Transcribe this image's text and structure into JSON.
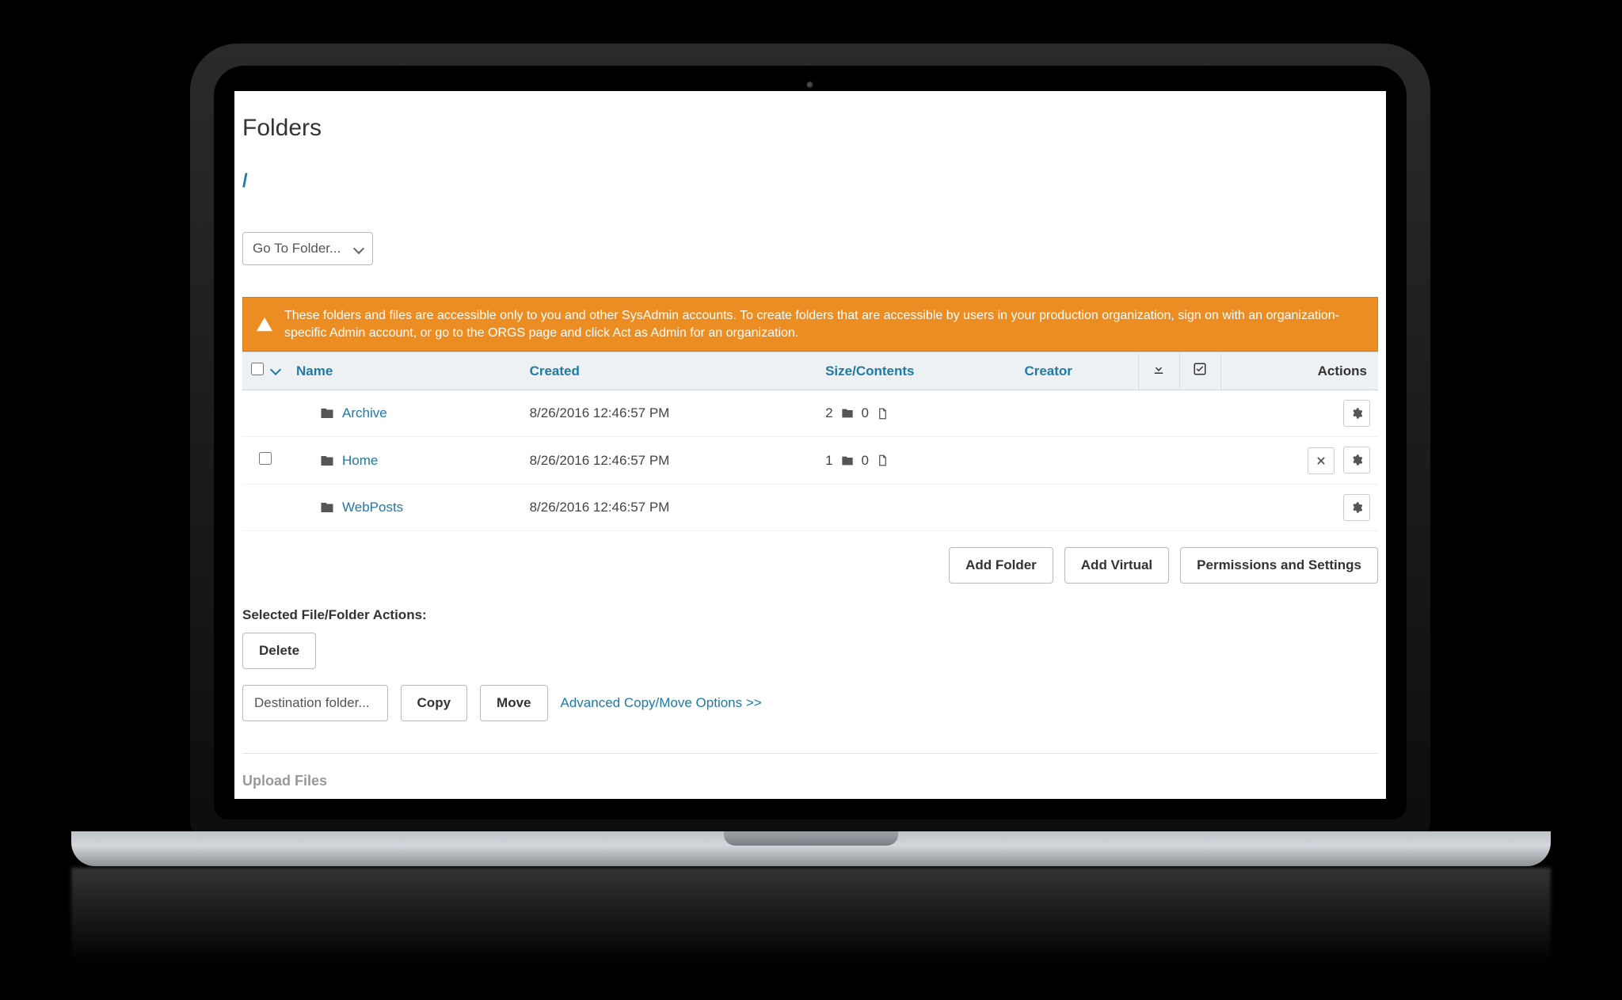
{
  "page": {
    "title": "Folders",
    "breadcrumb_root": "/"
  },
  "goto_folder": {
    "label": "Go To Folder..."
  },
  "alert": {
    "text": "These folders and files are accessible only to you and other SysAdmin accounts. To create folders that are accessible by users in your production organization, sign on with an organization-specific Admin account, or go to the ORGS page and click Act as Admin for an organization."
  },
  "table": {
    "headers": {
      "name": "Name",
      "created": "Created",
      "size": "Size/Contents",
      "creator": "Creator",
      "actions": "Actions"
    },
    "rows": [
      {
        "name": "Archive",
        "created": "8/26/2016 12:46:57 PM",
        "folders": "2",
        "files": "0",
        "creator": "",
        "checkable": false,
        "deletable": false
      },
      {
        "name": "Home",
        "created": "8/26/2016 12:46:57 PM",
        "folders": "1",
        "files": "0",
        "creator": "",
        "checkable": true,
        "deletable": true
      },
      {
        "name": "WebPosts",
        "created": "8/26/2016 12:46:57 PM",
        "folders": "",
        "files": "",
        "creator": "",
        "checkable": false,
        "deletable": false
      }
    ]
  },
  "buttons": {
    "add_folder": "Add Folder",
    "add_virtual": "Add Virtual",
    "permissions": "Permissions and Settings",
    "delete": "Delete",
    "copy": "Copy",
    "move": "Move"
  },
  "labels": {
    "selected_actions": "Selected File/Folder Actions:",
    "destination": "Destination folder...",
    "advanced_copy": "Advanced Copy/Move Options >>",
    "upload_files": "Upload Files"
  }
}
